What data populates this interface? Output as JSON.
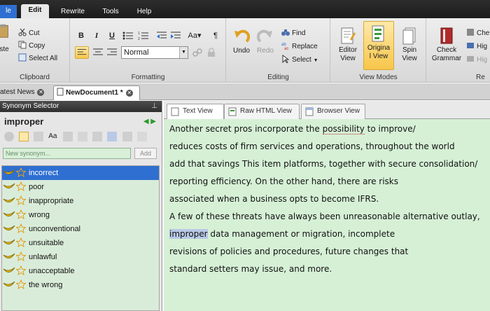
{
  "menu": {
    "file": "le",
    "edit": "Edit",
    "rewrite": "Rewrite",
    "tools": "Tools",
    "help": "Help"
  },
  "ribbon": {
    "clipboard": {
      "label": "Clipboard",
      "paste": "ste",
      "cut": "Cut",
      "copy": "Copy",
      "select_all": "Select All"
    },
    "formatting": {
      "label": "Formatting",
      "style_value": "Normal"
    },
    "editing": {
      "label": "Editing",
      "undo": "Undo",
      "redo": "Redo",
      "find": "Find",
      "replace": "Replace",
      "select": "Select"
    },
    "view_modes": {
      "label": "View Modes",
      "editor_view": "Editor View",
      "original_view": "Original View",
      "spin_view": "Spin View"
    },
    "proofing": {
      "check_grammar": "Check Grammar",
      "che": "Che",
      "hig1": "Hig",
      "hig2": "Hig",
      "re": "Re"
    }
  },
  "doc_tabs": {
    "latest_news": "atest News",
    "new_document": "NewDocument1 *"
  },
  "synonym_panel": {
    "title": "Synonym Selector",
    "word": "improper",
    "new_placeholder": "New synonym...",
    "add_label": "Add",
    "items": [
      {
        "label": "incorrect"
      },
      {
        "label": "poor"
      },
      {
        "label": "inappropriate"
      },
      {
        "label": "wrong"
      },
      {
        "label": "unconventional"
      },
      {
        "label": "unsuitable"
      },
      {
        "label": "unlawful"
      },
      {
        "label": "unacceptable"
      },
      {
        "label": "the wrong"
      }
    ]
  },
  "editor": {
    "tabs": {
      "text_view": "Text View",
      "raw_html_view": "Raw HTML View",
      "browser_view": "Browser View"
    },
    "lines": [
      {
        "a": "Another secret pros incorporate the ",
        "b": "possibility",
        "c": " to improve/"
      },
      {
        "a": "reduces costs of firm services and operations, throughout the world"
      },
      {
        "a": "add that savings This item platforms, together with secure consolidation/"
      },
      {
        "a": "reporting efficiency. On the other hand, there are risks"
      },
      {
        "a": "associated when a business opts to become IFRS."
      },
      {
        "a": "A few of these threats have always been unreasonable alternative outlay,"
      },
      {
        "a": "improper",
        "c": " data management or migration, incomplete"
      },
      {
        "a": "revisions of policies and procedures, future changes that"
      },
      {
        "a": "standard setters may issue, and more."
      }
    ]
  },
  "colors": {
    "menu_bg": "#1c1c1c",
    "accent_blue": "#2f6fd1",
    "text_bg": "#d6f0d6",
    "active_view": "#f7c64a"
  }
}
